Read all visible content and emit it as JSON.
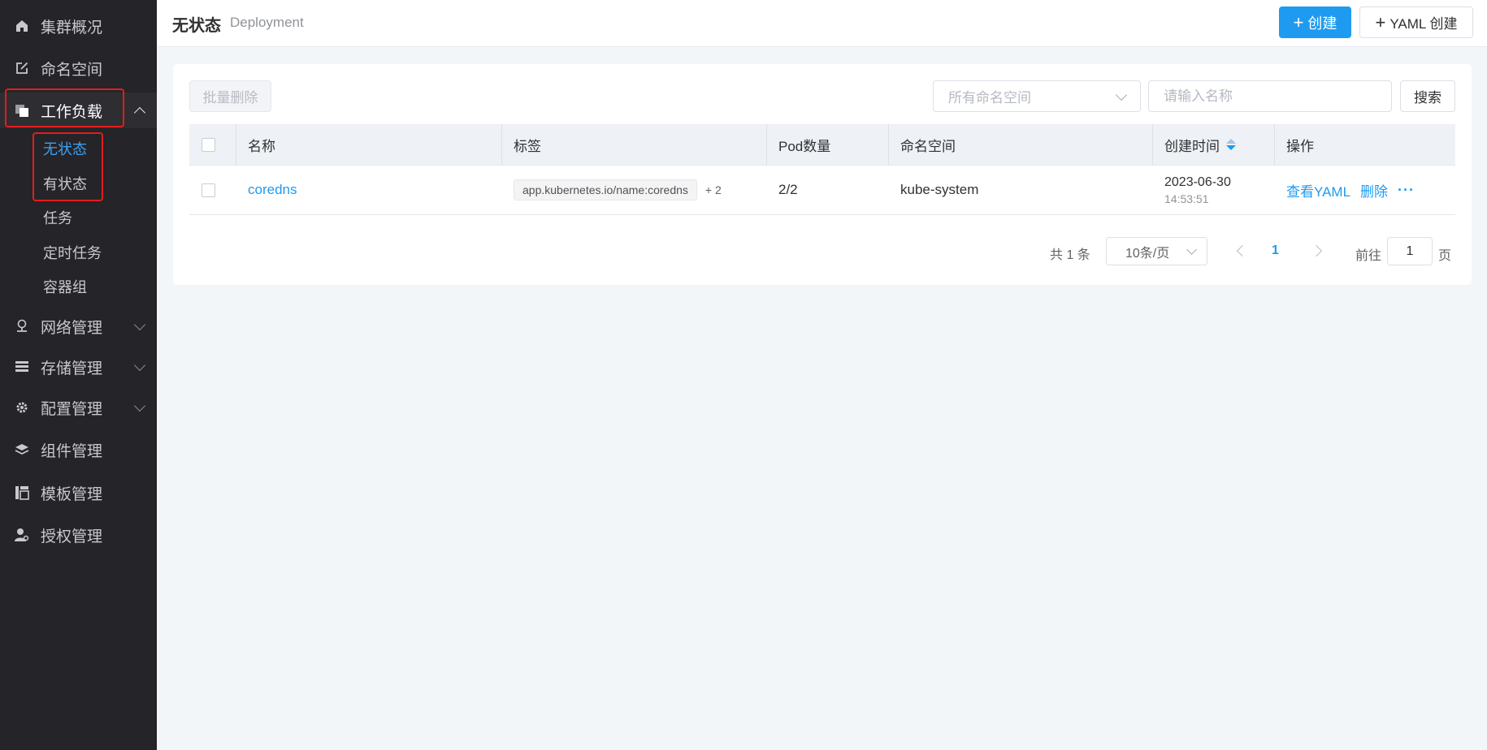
{
  "sidebar": {
    "items": [
      {
        "label": "集群概况",
        "icon": "home-icon"
      },
      {
        "label": "命名空间",
        "icon": "edit-icon"
      },
      {
        "label": "工作负载",
        "icon": "workload-icon",
        "expanded": true
      },
      {
        "label": "网络管理",
        "icon": "network-icon"
      },
      {
        "label": "存储管理",
        "icon": "storage-icon"
      },
      {
        "label": "配置管理",
        "icon": "gear-icon"
      },
      {
        "label": "组件管理",
        "icon": "layers-icon"
      },
      {
        "label": "模板管理",
        "icon": "template-icon"
      },
      {
        "label": "授权管理",
        "icon": "user-key-icon"
      }
    ],
    "workload_sub": [
      {
        "label": "无状态",
        "active": true
      },
      {
        "label": "有状态"
      },
      {
        "label": "任务"
      },
      {
        "label": "定时任务"
      },
      {
        "label": "容器组"
      }
    ]
  },
  "header": {
    "title": "无状态",
    "subtitle": "Deployment",
    "create_label": "创建",
    "yaml_create_label": "YAML 创建"
  },
  "toolbar": {
    "batch_delete_label": "批量删除",
    "namespace_placeholder": "所有命名空间",
    "name_placeholder": "请输入名称",
    "search_label": "搜索"
  },
  "table": {
    "columns": [
      "名称",
      "标签",
      "Pod数量",
      "命名空间",
      "创建时间",
      "操作"
    ],
    "rows": [
      {
        "name": "coredns",
        "label_tag": "app.kubernetes.io/name:coredns",
        "label_more": "+ 2",
        "pods": "2/2",
        "namespace": "kube-system",
        "created_date": "2023-06-30",
        "created_time": "14:53:51",
        "op_view": "查看YAML",
        "op_delete": "删除",
        "op_more": "···"
      }
    ]
  },
  "pagination": {
    "total": "共 1 条",
    "page_size": "10条/页",
    "current_page": "1",
    "goto_label": "前往",
    "goto_value": "1",
    "goto_suffix": "页"
  },
  "colors": {
    "primary": "#1e9bf0",
    "sidebar_bg": "#252428",
    "highlight": "#e21d1d"
  }
}
